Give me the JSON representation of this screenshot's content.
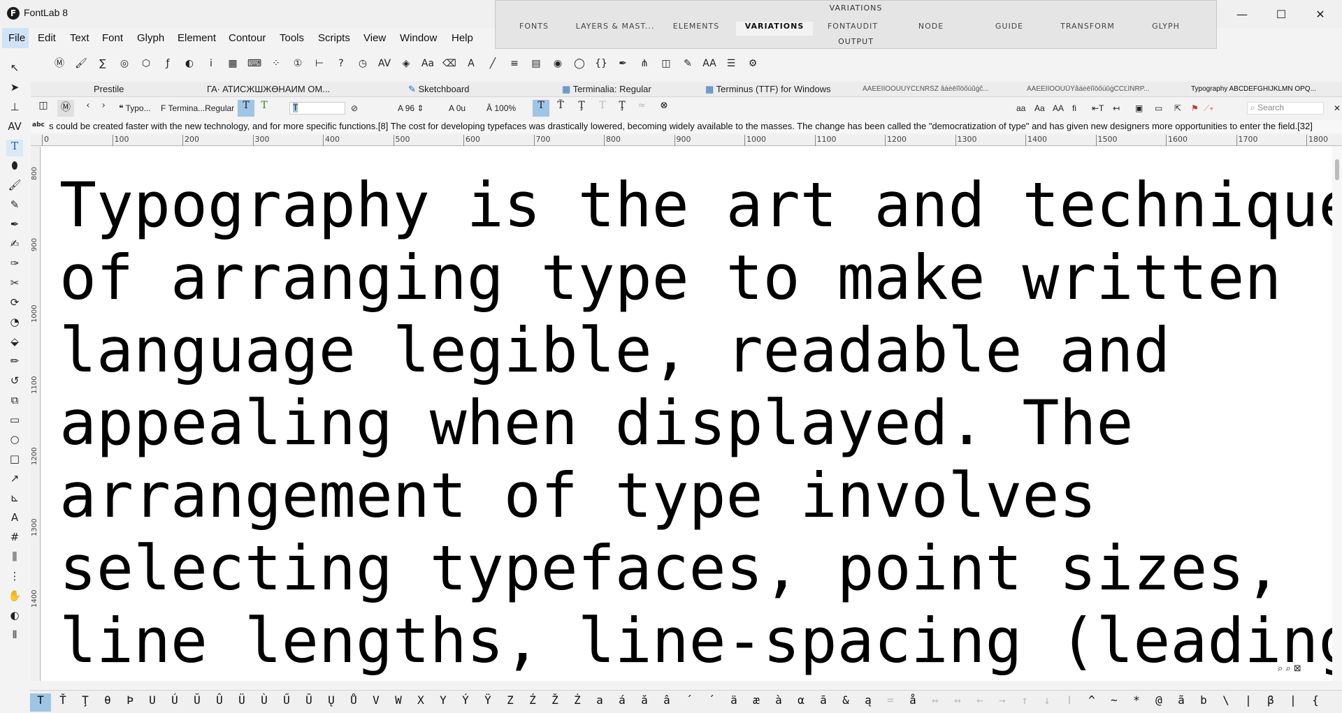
{
  "window": {
    "title": "FontLab 8",
    "logo_letter": "F",
    "minimize": "—",
    "maximize": "☐",
    "close": "✕"
  },
  "menu": [
    "File",
    "Edit",
    "Text",
    "Font",
    "Glyph",
    "Element",
    "Contour",
    "Tools",
    "Scripts",
    "View",
    "Window",
    "Help"
  ],
  "variations_panel": {
    "title": "VARIATIONS",
    "tabs": [
      "FONTS",
      "LAYERS & MAST...",
      "ELEMENTS",
      "VARIATIONS",
      "FONTAUDIT",
      "NODE",
      "GUIDE",
      "TRANSFORM",
      "GLYPH"
    ],
    "active_tab": "VARIATIONS",
    "output": "OUTPUT"
  },
  "toolbar_icons": [
    "font-info-icon",
    "brush-icon",
    "sigma-icon",
    "palette-icon",
    "puzzle-icon",
    "function-icon",
    "moon-icon",
    "info-icon",
    "grid-icon",
    "keyboard-icon",
    "grid-dots-icon",
    "number-icon",
    "measure-icon",
    "help-icon",
    "clock-icon",
    "kern-icon",
    "layers-icon",
    "text-aa-icon",
    "eraser-icon",
    "text-box-icon",
    "knife-icon",
    "align-icon",
    "grid2-icon",
    "eye-icon",
    "lasso-icon",
    "braces-icon",
    "pen-nib-icon",
    "tree-icon",
    "shapes-icon",
    "pen-icon",
    "aa-icon",
    "list-icon",
    "gear-icon"
  ],
  "toolbar_glyphs": [
    "Ⓜ",
    "🖌",
    "∑",
    "◎",
    "⬡",
    "ƒ",
    "◐",
    "i",
    "▦",
    "⌨",
    "⁘",
    "①",
    "⊢",
    "?",
    "◷",
    "AV",
    "◈",
    "Aa",
    "⌫",
    "A",
    "╱",
    "≡",
    "▤",
    "◉",
    "◯",
    "{}",
    "✒",
    "⋔",
    "◫",
    "✎",
    "AA",
    "☰",
    "⚙"
  ],
  "doc_tabs": [
    {
      "label": "Prestile",
      "small": false
    },
    {
      "label": "ГА∙ АТИСЖШЖӨНАИМ ОМ...",
      "small": false
    },
    {
      "label": "Sketchboard",
      "small": false
    },
    {
      "label": "Terminalia: Regular",
      "small": false
    },
    {
      "label": "Terminus (TTF) for Windows",
      "small": false
    },
    {
      "label": "ĀĂĖĒĪĪŌŐŪŬŸĈĽŇŔŠŽ âáėēīĭōőúŭġĉ...",
      "small": true
    },
    {
      "label": "ĀĂĖĒĪĪŌŐŪŮŸãáėēīĭōőúŭġĈĊĽĪŇŔP...",
      "small": true
    },
    {
      "label": "Typography  ABCDEFGHIJKLMN OPQ...",
      "small": true
    }
  ],
  "glyph_bar": {
    "text_name": "Typo...",
    "font_name": "Termina...Regular",
    "glyph_input": "T",
    "size": "96",
    "tracking": "0u",
    "zoom": "100%",
    "search_placeholder": "Search"
  },
  "text_line": "s could be created faster with the new technology, and for more specific functions.[8] The cost for developing typefaces was drastically lowered, becoming widely available to the masses. The change has been called the \"democratization of type\" and has given new designers more opportunities to enter the field.[32]",
  "text_line_prefix": "abc",
  "ruler_ticks": [
    "0",
    "100",
    "200",
    "300",
    "400",
    "500",
    "600",
    "700",
    "800",
    "900",
    "1000",
    "1100",
    "1200",
    "1300",
    "1400",
    "1500",
    "1600",
    "1700",
    "1800"
  ],
  "vruler_ticks": [
    "800",
    "900",
    "1000",
    "1100",
    "1200",
    "1300",
    "1400"
  ],
  "canvas_lines": [
    "Typography is the art and technique",
    "of arranging type to make written",
    "language legible, readable and",
    "appealing when displayed. The",
    "arrangement of type involves",
    "selecting typefaces, point sizes,",
    "line lengths, line-spacing (leading),"
  ],
  "left_tools": [
    "↖",
    "➤",
    "⊥",
    "AV",
    "T",
    "⬮",
    "🖌",
    "✎",
    "✒",
    "✍",
    "✑",
    "✂",
    "⟳",
    "◔",
    "⬙",
    "✏",
    "↺",
    "⧉",
    "▭",
    "○",
    "□",
    "↗",
    "⊾",
    "A",
    "#",
    "⫼",
    "⋮",
    "✋",
    "◐",
    "⦀"
  ],
  "glyph_strip": [
    "T",
    "Ť",
    "Ţ",
    "θ",
    "Þ",
    "U",
    "Ú",
    "Ŭ",
    "Û",
    "Ü",
    "Ù",
    "Ű",
    "Ū",
    "Ų",
    "Ů",
    "V",
    "W",
    "X",
    "Y",
    "Ý",
    "Ÿ",
    "Z",
    "Ź",
    "Ž",
    "Ż",
    "a",
    "á",
    "ă",
    "â",
    "´",
    "´",
    "ä",
    "æ",
    "à",
    "α",
    "ā",
    "&",
    "ą",
    "=",
    "å",
    "↔",
    "↔",
    "←",
    "→",
    "↑",
    "↓",
    "ǀ",
    "^",
    "~",
    "*",
    "@",
    "ã",
    "b",
    "\\",
    "|",
    "β",
    "|",
    "{"
  ]
}
